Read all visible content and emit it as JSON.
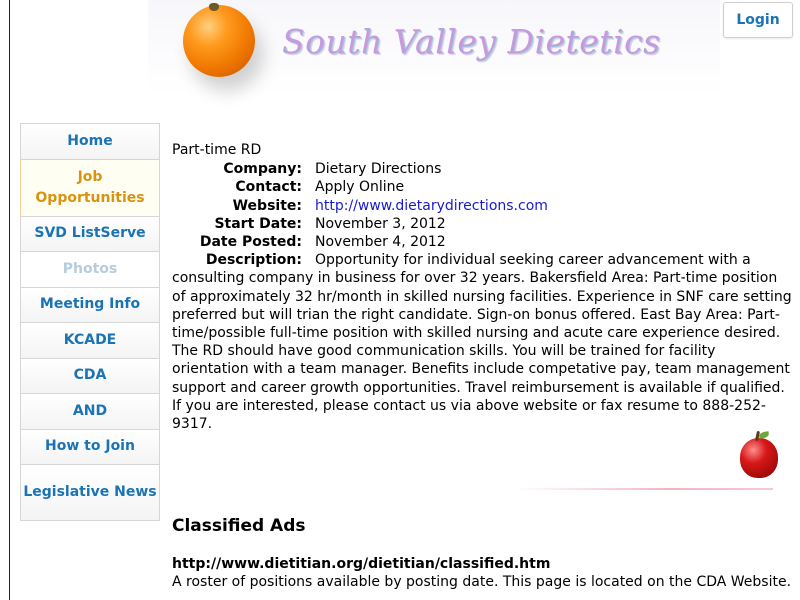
{
  "header": {
    "site_title": "South Valley Dietetics",
    "login_label": "Login"
  },
  "nav": {
    "items": [
      {
        "label": "Home"
      },
      {
        "label": "Job Opportunities"
      },
      {
        "label": "SVD ListServe"
      },
      {
        "label": "Photos"
      },
      {
        "label": "Meeting Info"
      },
      {
        "label": "KCADE"
      },
      {
        "label": "CDA"
      },
      {
        "label": "AND"
      },
      {
        "label": "How to Join"
      },
      {
        "label": "Legislative News"
      }
    ]
  },
  "job": {
    "title": "Part-time RD",
    "labels": {
      "company": "Company:",
      "contact": "Contact:",
      "website": "Website:",
      "start_date": "Start Date:",
      "date_posted": "Date Posted:",
      "description": "Description:"
    },
    "company": "Dietary Directions",
    "contact": "Apply Online",
    "website": "http://www.dietarydirections.com",
    "start_date": "November 3, 2012",
    "date_posted": "November 4, 2012",
    "description": "Opportunity for individual seeking career advancement with a consulting company in business for over 32 years. Bakersfield Area: Part-time position of approximately 32 hr/month in skilled nursing facilities. Experience in SNF care setting preferred but will trian the right candidate. Sign-on bonus offered. East Bay Area: Part-time/possible full-time position with skilled nursing and acute care experience desired. The RD should have good communication skills. You will be trained for facility orientation with a team manager. Benefits include competative pay, team management support and career growth opportunities. Travel reimbursement is available if qualified. If you are interested, please contact us via above website or fax resume to 888-252-9317."
  },
  "classified": {
    "heading": "Classified Ads",
    "url": "http://www.dietitian.org/dietitian/classified.htm",
    "description": "A roster of positions available by posting date. This page is located on the CDA Website."
  },
  "colors": {
    "link": "#1a73b5",
    "active_nav": "#d99312",
    "title": "#c79ae0"
  }
}
